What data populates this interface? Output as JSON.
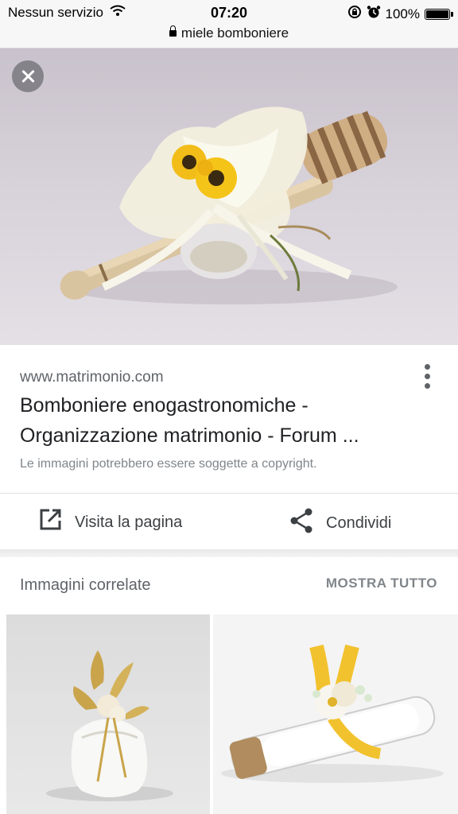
{
  "status_bar": {
    "carrier": "Nessun servizio",
    "time": "07:20",
    "battery": "100%"
  },
  "url_bar": {
    "url": "miele bomboniere"
  },
  "result": {
    "domain": "www.matrimonio.com",
    "title_line1": "Bomboniere enogastronomiche -",
    "title_line2": "Organizzazione matrimonio - Forum ...",
    "copyright_note": "Le immagini potrebbero essere soggette a copyright."
  },
  "actions": {
    "visit_label": "Visita la pagina",
    "share_label": "Condividi"
  },
  "related": {
    "title": "Immagini correlate",
    "show_all": "MOSTRA TUTTO"
  },
  "icons": {
    "wifi": "wifi-icon",
    "lock": "lock-icon",
    "close": "close-icon",
    "more": "more-vert-icon",
    "open": "open-in-new-icon",
    "share": "share-icon"
  },
  "colors": {
    "text_primary": "#202124",
    "text_secondary": "#5f6368",
    "hero_background": "#d7d1d9",
    "ribbon_yellow": "#f2c22e"
  }
}
